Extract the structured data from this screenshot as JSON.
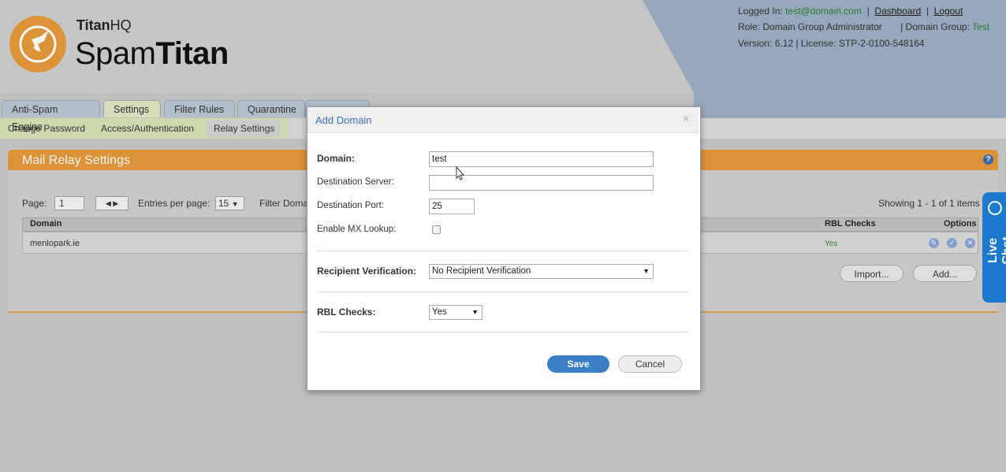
{
  "header": {
    "brand_small_a": "Titan",
    "brand_small_b": "HQ",
    "brand_big_a": "Spam",
    "brand_big_b": "Titan",
    "logged_in_label": "Logged In:",
    "logged_in_user": "test@domain.com",
    "sep1": "|",
    "dashboard": "Dashboard",
    "sep2": "|",
    "logout": "Logout",
    "role": "Role: Domain Group Administrator",
    "domain_group_label": "| Domain Group:",
    "domain_group_value": "Test",
    "version": "Version: 6.12  |  License: STP-2-0100-548164"
  },
  "tabs": [
    "Anti-Spam Engine",
    "Settings",
    "Filter Rules",
    "Quarantine"
  ],
  "subtabs": [
    "Change Password",
    "Access/Authentication",
    "Relay Settings"
  ],
  "panel": {
    "title": "Mail Relay Settings",
    "page_label": "Page:",
    "page_value": "1",
    "entries_label": "Entries per page:",
    "entries_value": "15",
    "filter_label": "Filter Doma",
    "showing": "Showing 1 - 1 of 1 items",
    "col_domain": "Domain",
    "col_rbl": "RBL Checks",
    "col_options": "Options",
    "row_domain": "menlopark.ie",
    "row_rbl": "Yes",
    "import_btn": "Import...",
    "add_btn": "Add..."
  },
  "livechat": "Live Chat",
  "dialog": {
    "title": "Add Domain",
    "close": "×",
    "domain_label": "Domain:",
    "domain_value": "test",
    "dest_server_label": "Destination Server:",
    "dest_server_value": "",
    "dest_port_label": "Destination Port:",
    "dest_port_value": "25",
    "mx_label": "Enable MX Lookup:",
    "recip_label": "Recipient Verification:",
    "recip_value": "No Recipient Verification",
    "rbl_label": "RBL Checks:",
    "rbl_value": "Yes",
    "save": "Save",
    "cancel": "Cancel"
  }
}
